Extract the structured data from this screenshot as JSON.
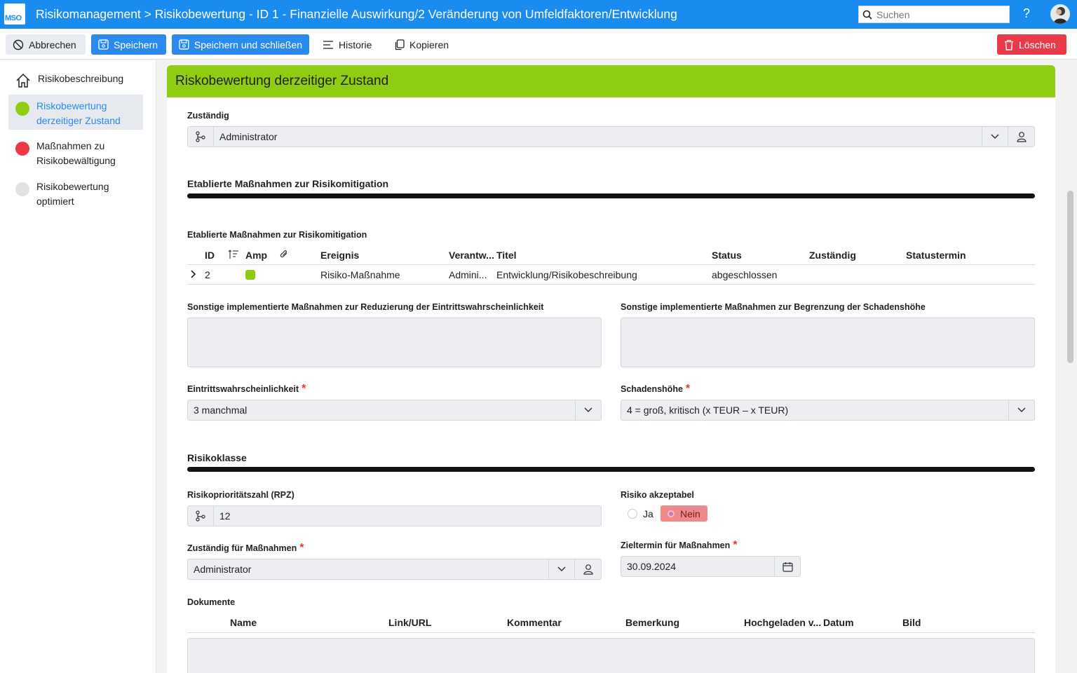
{
  "app": {
    "logo_text": "MSO",
    "title": "Risikomanagement > Risikobewertung - ID 1 - Finanzielle Auswirkung/2 Veränderung von Umfeldfaktoren/Entwicklung",
    "search_placeholder": "Suchen",
    "help": "?"
  },
  "toolbar": {
    "cancel": "Abbrechen",
    "save": "Speichern",
    "save_close": "Speichern und schließen",
    "history": "Historie",
    "copy": "Kopieren",
    "delete": "Löschen"
  },
  "sidebar": {
    "items": [
      {
        "label": "Risikobeschreibung",
        "icon": "home-icon"
      },
      {
        "label": "Riskobewertung derzeitiger Zustand",
        "color": "#8fcd12",
        "active": true
      },
      {
        "label": "Maßnahmen zu Risikobewältigung",
        "color": "#ea3a4a"
      },
      {
        "label": "Risikobewertung optimiert",
        "color": "#e2e2e2"
      }
    ]
  },
  "card": {
    "title": "Riskobewertung derzeitiger Zustand",
    "zustaendig": {
      "label": "Zuständig",
      "value": "Administrator"
    },
    "section1": "Etablierte Maßnahmen zur Risikomitigation",
    "table": {
      "caption": "Etablierte Maßnahmen zur Risikomitigation",
      "headers": [
        "ID",
        "Amp",
        "Ereignis",
        "Verantw...",
        "Titel",
        "Status",
        "Zuständig",
        "Statustermin"
      ],
      "rows": [
        {
          "id": "2",
          "amp_color": "#8fcd12",
          "ereignis": "Risiko-Maßnahme",
          "verantw": "Admini...",
          "titel": "Entwicklung/Risikobeschreibung",
          "status": "abgeschlossen",
          "zustaendig": "",
          "statustermin": ""
        }
      ]
    },
    "sonstige1": {
      "label": "Sonstige implementierte Maßnahmen zur Reduzierung der Eintrittswahrscheinlichkeit",
      "value": ""
    },
    "sonstige2": {
      "label": "Sonstige implementierte Maßnahmen zur Begrenzung der Schadenshöhe",
      "value": ""
    },
    "eintritt": {
      "label": "Eintrittswahrscheinlichkeit",
      "value": "3 manchmal"
    },
    "schaden": {
      "label": "Schadenshöhe",
      "value": "4 = groß, kritisch (x TEUR – x TEUR)"
    },
    "section2": "Risikoklasse",
    "rpz": {
      "label": "Risikoprioritätszahl (RPZ)",
      "value": "12"
    },
    "akzeptabel": {
      "label": "Risiko akzeptabel",
      "yes": "Ja",
      "no": "Nein",
      "selected": "Nein"
    },
    "zust_massnahmen": {
      "label": "Zuständig für Maßnahmen",
      "value": "Administrator"
    },
    "zieltermin": {
      "label": "Zieltermin für Maßnahmen",
      "value": "30.09.2024"
    },
    "dokumente": {
      "label": "Dokumente",
      "headers": [
        "Name",
        "Link/URL",
        "Kommentar",
        "Bemerkung",
        "Hochgeladen v...",
        "Datum",
        "Bild"
      ]
    },
    "required_mark": "*"
  }
}
